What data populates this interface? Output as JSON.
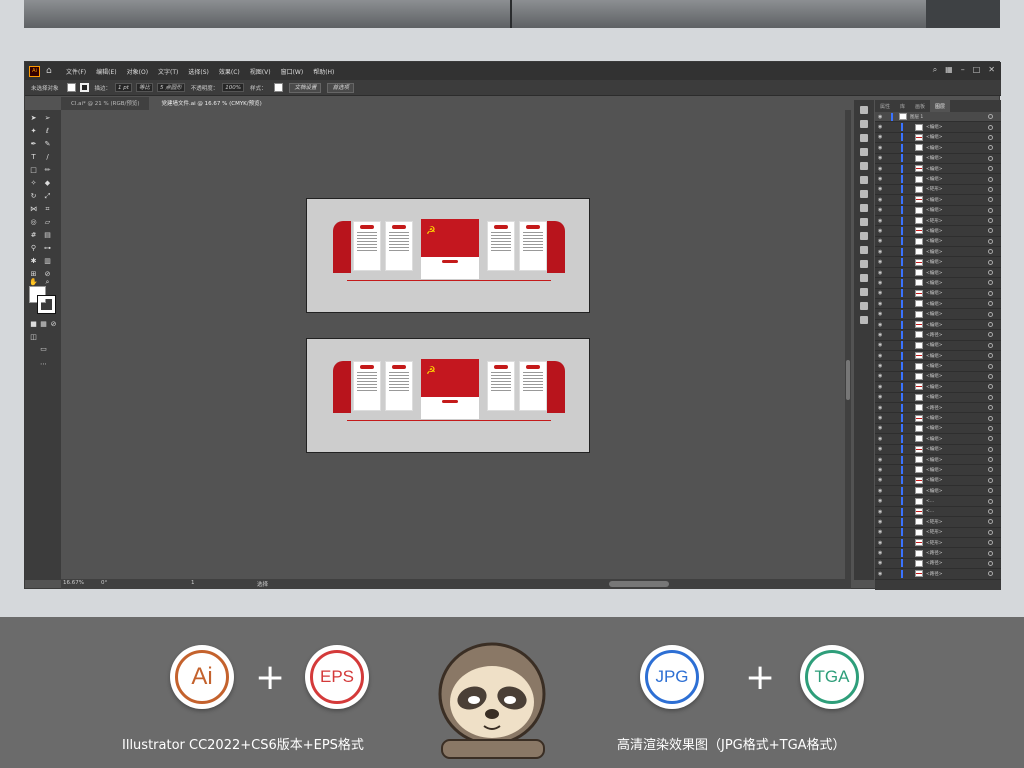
{
  "window": {
    "menus": [
      "文件(F)",
      "编辑(E)",
      "对象(O)",
      "文字(T)",
      "选择(S)",
      "效果(C)",
      "视图(V)",
      "窗口(W)",
      "帮助(H)"
    ]
  },
  "control_bar": {
    "no_selection": "未选择对象",
    "stroke_label": "描边：",
    "stroke_value": "1 pt",
    "stroke_style": "等比",
    "brush": "5 点圆形",
    "opacity_label": "不透明度：",
    "opacity_value": "100%",
    "style_label": "样式：",
    "doc_setup": "文档设置",
    "prefs": "首选项"
  },
  "tabs": [
    {
      "label": "Cl.ai* @ 21 % (RGB/预览)"
    },
    {
      "label": "党建墙文件.ai @ 16.67 % (CMYK/预览)"
    }
  ],
  "status_bar": {
    "zoom": "16.67%",
    "rotation": "0°",
    "page": "1",
    "selection_tool": "选择"
  },
  "layers_panel": {
    "tabs": [
      "属性",
      "库",
      "画板",
      "图层"
    ],
    "top_layer": "图层 1",
    "rows": [
      "<编组>",
      "<编组>",
      "<编组>",
      "<编组>",
      "<编组>",
      "<编组>",
      "<矩形>",
      "<编组>",
      "<编组>",
      "<矩形>",
      "<编组>",
      "<编组>",
      "<编组>",
      "<编组>",
      "<编组>",
      "<编组>",
      "<编组>",
      "<编组>",
      "<编组>",
      "<编组>",
      "<路径>",
      "<编组>",
      "<编组>",
      "<编组>",
      "<编组>",
      "<编组>",
      "<编组>",
      "<路径>",
      "<编组>",
      "<编组>",
      "<编组>",
      "<编组>",
      "<编组>",
      "<编组>",
      "<编组>",
      "<编组>",
      "<...",
      "<...",
      "<矩形>",
      "<矩形>",
      "<矩形>",
      "<路径>",
      "<路径>",
      "<路径>"
    ]
  },
  "footer": {
    "badges": [
      {
        "label": "Ai",
        "color": "#c4622d"
      },
      {
        "label": "EPS",
        "color": "#d43a3a"
      },
      {
        "label": "JPG",
        "color": "#2d6fd4"
      },
      {
        "label": "TGA",
        "color": "#2e9e7a"
      }
    ],
    "plus": "+",
    "caption_left": "Illustrator CC2022+CS6版本+EPS格式",
    "caption_right": "高清渲染效果图（JPG格式+TGA格式）"
  }
}
